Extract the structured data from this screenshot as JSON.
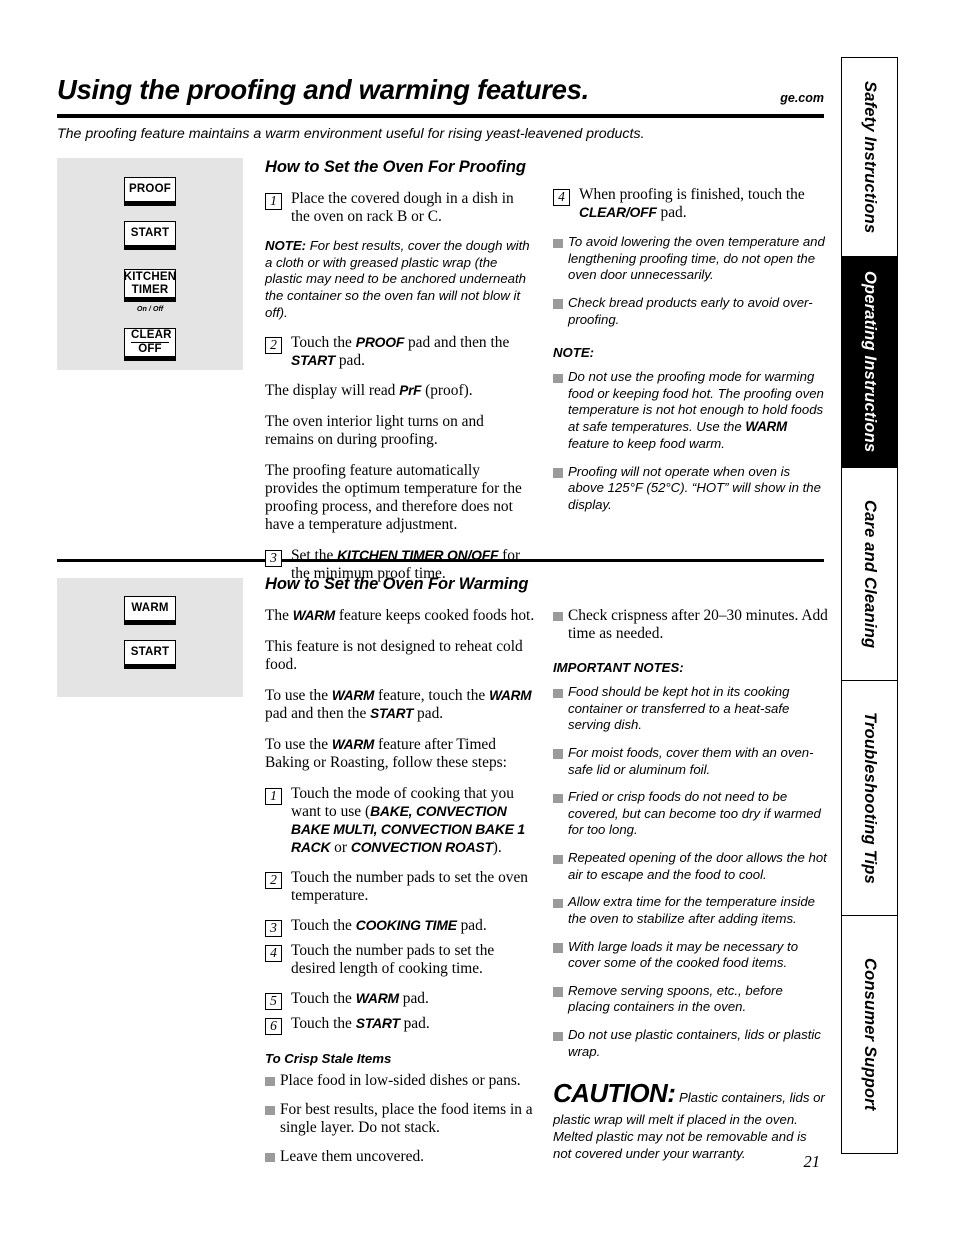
{
  "header": {
    "title": "Using the proofing and warming features.",
    "brand_url": "ge.com",
    "intro": "The proofing feature maintains a warm environment useful for rising yeast-leavened products."
  },
  "side_tabs": [
    {
      "label": "Safety Instructions",
      "active": false
    },
    {
      "label": "Operating Instructions",
      "active": true
    },
    {
      "label": "Care and Cleaning",
      "active": false
    },
    {
      "label": "Troubleshooting Tips",
      "active": false
    },
    {
      "label": "Consumer Support",
      "active": false
    }
  ],
  "proofing": {
    "heading": "How to Set the Oven For Proofing",
    "pads": [
      {
        "name": "proof-pad",
        "label": "PROOF",
        "sub": ""
      },
      {
        "name": "start-pad",
        "label": "START",
        "sub": ""
      },
      {
        "name": "kitchen-timer-pad",
        "line1": "KITCHEN",
        "line2": "TIMER",
        "sub": "On / Off"
      },
      {
        "name": "clear-off-pad",
        "line1": "CLEAR",
        "line2": "OFF",
        "sub": ""
      }
    ],
    "step1_num": "1",
    "step1_text": "Place the covered dough in a dish in the oven on rack B or C.",
    "note_label": "NOTE:",
    "note_text": " For best results, cover the dough with a cloth or with greased plastic wrap (the plastic may need to be anchored underneath the container so the oven fan will not blow it off).",
    "step2_num": "2",
    "step2_a": "Touch the ",
    "step2_pad1": "PROOF",
    "step2_b": " pad and then the ",
    "step2_pad2": "START",
    "step2_c": " pad.",
    "para_display_a": "The display will read ",
    "para_display_pad": "PrF",
    "para_display_b": " (proof).",
    "para_light": "The oven interior light turns on and remains on during proofing.",
    "para_auto": "The proofing feature automatically provides the optimum temperature for the proofing process, and therefore does not have a temperature adjustment.",
    "step3_num": "3",
    "step3_a": "Set the ",
    "step3_pad": "KITCHEN TIMER ON/OFF",
    "step3_b": " for the minimum proof time.",
    "step4_num": "4",
    "step4_a": "When proofing is finished, touch the ",
    "step4_pad": "CLEAR/OFF",
    "step4_b": " pad.",
    "bullets": [
      "To avoid lowering the oven temperature and lengthening proofing time, do not open the oven door unnecessarily.",
      "Check bread products early to avoid over-proofing."
    ],
    "note_head": "NOTE:",
    "note_bullet1_a": "Do not use the proofing mode for warming food or keeping food hot. The proofing oven temperature is not hot enough to hold foods at safe temperatures. Use the ",
    "note_bullet1_pad": "WARM",
    "note_bullet1_b": " feature to keep food warm.",
    "note_bullet2": "Proofing will not operate when oven is above 125°F (52°C). “HOT” will show in the display."
  },
  "warming": {
    "heading": "How to Set the Oven For Warming",
    "pads": [
      {
        "name": "warm-pad",
        "label": "WARM"
      },
      {
        "name": "start-pad",
        "label": "START"
      }
    ],
    "para1_a": "The ",
    "para1_pad": "WARM",
    "para1_b": " feature keeps cooked foods hot.",
    "para2": "This feature is not designed to reheat cold food.",
    "para3_a": "To use the ",
    "para3_pad1": "WARM",
    "para3_b": " feature, touch the ",
    "para3_pad2": "WARM",
    "para3_c": " pad and then the ",
    "para3_pad3": "START",
    "para3_d": " pad.",
    "para4_a": "To use the ",
    "para4_pad": "WARM",
    "para4_b": " feature after Timed Baking or Roasting, follow these steps:",
    "step1_num": "1",
    "step1_a": "Touch the mode of cooking that you want to use (",
    "step1_pad1": "BAKE, CONVECTION BAKE MULTI, CONVECTION BAKE 1 RACK",
    "step1_b": " or ",
    "step1_pad2": "CONVECTION ROAST",
    "step1_c": ").",
    "step2_num": "2",
    "step2_text": "Touch the number pads to set the oven temperature.",
    "step3_num": "3",
    "step3_a": "Touch the ",
    "step3_pad": "COOKING TIME",
    "step3_b": " pad.",
    "step4_num": "4",
    "step4_text": "Touch the number pads to set the desired length of cooking time.",
    "step5_num": "5",
    "step5_a": "Touch the ",
    "step5_pad": "WARM",
    "step5_b": " pad.",
    "step6_num": "6",
    "step6_a": "Touch the ",
    "step6_pad": "START",
    "step6_b": " pad.",
    "crisp_head": "To Crisp Stale Items",
    "crisp_bullets": [
      "Place food in low-sided dishes or pans.",
      "For best results, place the food items in a single layer. Do not stack.",
      "Leave them uncovered."
    ],
    "crisp_bullet_right": "Check crispness after 20–30 minutes. Add time as needed.",
    "important_head": "IMPORTANT NOTES:",
    "important_bullets": [
      "Food should be kept hot in its cooking container or transferred to a heat-safe serving dish.",
      "For moist foods, cover them with an oven-safe lid or aluminum foil.",
      "Fried or crisp foods do not need to be covered, but can become too dry if warmed for too long.",
      "Repeated opening of the door allows the hot air to escape and the food to cool.",
      "Allow extra time for the temperature inside the oven to stabilize after adding items.",
      "With large loads it may be necessary to cover some of the cooked food items.",
      "Remove serving spoons, etc., before placing containers in the oven.",
      "Do not use plastic containers, lids or plastic wrap."
    ],
    "caution_word": "CAUTION:",
    "caution_text": " Plastic containers, lids or plastic wrap will melt if placed in the oven. Melted plastic may not be removable and is not covered under your warranty."
  },
  "footer": {
    "page_number": "21"
  },
  "colors": {
    "panel_gray": "#e4e4e4",
    "bullet_gray": "#9b9b9b",
    "ink": "#000000"
  }
}
